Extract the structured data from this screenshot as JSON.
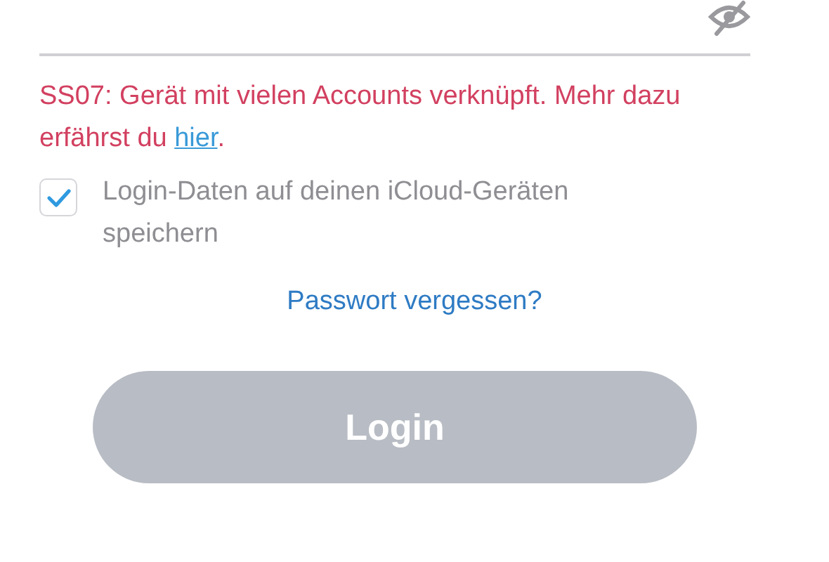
{
  "password_field": {
    "masked": true
  },
  "error": {
    "text": "SS07: Gerät mit vielen Accounts verknüpft. Mehr dazu erfährst du ",
    "link": "hier",
    "end": "."
  },
  "remember": {
    "label": "Login-Daten auf deinen iCloud-Geräten speichern",
    "checked": true
  },
  "forgot_link": "Passwort vergessen?",
  "login_button": {
    "label": "Login",
    "disabled": true
  }
}
